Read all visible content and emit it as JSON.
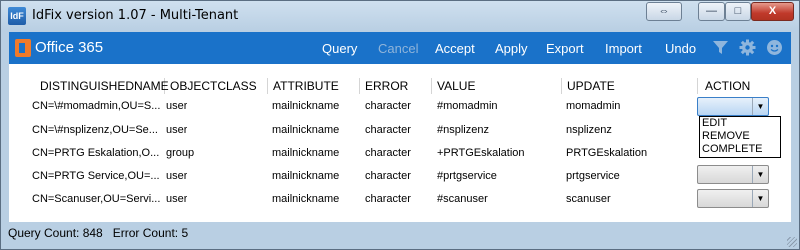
{
  "window": {
    "title": "IdFix version 1.07 - Multi-Tenant",
    "app_icon_text": "IdF",
    "close_label": "X",
    "maximize_glyph": "□",
    "minimize_glyph": "—",
    "resize_glyph": "⇔"
  },
  "toolbar": {
    "brand": "Office 365",
    "query": "Query",
    "cancel": "Cancel",
    "accept": "Accept",
    "apply": "Apply",
    "export": "Export",
    "import": "Import",
    "undo": "Undo",
    "icons": [
      "filter-icon",
      "gear-icon",
      "smiley-icon"
    ]
  },
  "grid": {
    "columns": [
      "DISTINGUISHEDNAME",
      "OBJECTCLASS",
      "ATTRIBUTE",
      "ERROR",
      "VALUE",
      "UPDATE",
      "ACTION"
    ],
    "rows": [
      {
        "dn": "CN=\\#momadmin,OU=S...",
        "objectclass": "user",
        "attribute": "mailnickname",
        "error": "character",
        "value": "#momadmin",
        "update": "momadmin"
      },
      {
        "dn": "CN=\\#nsplizenz,OU=Se...",
        "objectclass": "user",
        "attribute": "mailnickname",
        "error": "character",
        "value": "#nsplizenz",
        "update": "nsplizenz"
      },
      {
        "dn": "CN=PRTG Eskalation,O...",
        "objectclass": "group",
        "attribute": "mailnickname",
        "error": "character",
        "value": "+PRTGEskalation",
        "update": "PRTGEskalation"
      },
      {
        "dn": "CN=PRTG Service,OU=...",
        "objectclass": "user",
        "attribute": "mailnickname",
        "error": "character",
        "value": "#prtgservice",
        "update": "prtgservice"
      },
      {
        "dn": "CN=Scanuser,OU=Servi...",
        "objectclass": "user",
        "attribute": "mailnickname",
        "error": "character",
        "value": "#scanuser",
        "update": "scanuser"
      }
    ],
    "action_options": [
      "EDIT",
      "REMOVE",
      "COMPLETE"
    ]
  },
  "status": {
    "query_count_label": "Query Count: 848",
    "error_count_label": "Error Count: 5"
  },
  "colors": {
    "toolbar": "#1a72c9",
    "brand_logo": "#f07a2a"
  }
}
